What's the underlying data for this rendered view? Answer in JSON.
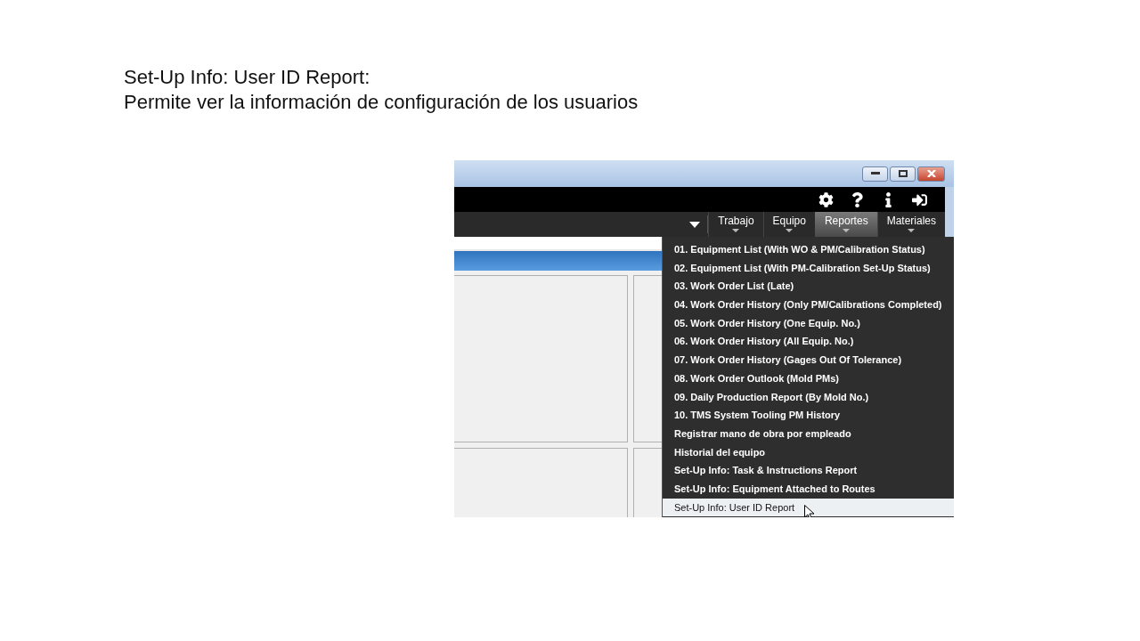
{
  "slide": {
    "heading": "Set-Up Info: User ID Report:",
    "subheading": "Permite ver la información de configuración de los usuarios"
  },
  "nav": {
    "tabs": [
      {
        "label": "Trabajo",
        "selected": false
      },
      {
        "label": "Equipo",
        "selected": false
      },
      {
        "label": "Reportes",
        "selected": true
      },
      {
        "label": "Materiales",
        "selected": false
      }
    ]
  },
  "menu": {
    "items": [
      {
        "label": "01. Equipment List (With WO & PM/Calibration Status)",
        "selected": false
      },
      {
        "label": "02. Equipment List (With PM-Calibration Set-Up Status)",
        "selected": false
      },
      {
        "label": "03. Work Order List (Late)",
        "selected": false
      },
      {
        "label": "04. Work Order History (Only PM/Calibrations Completed)",
        "selected": false
      },
      {
        "label": "05. Work Order History (One Equip. No.)",
        "selected": false
      },
      {
        "label": "06. Work Order History (All Equip. No.)",
        "selected": false
      },
      {
        "label": "07. Work Order History (Gages Out Of Tolerance)",
        "selected": false
      },
      {
        "label": "08. Work Order Outlook (Mold PMs)",
        "selected": false
      },
      {
        "label": "09. Daily Production Report (By Mold No.)",
        "selected": false
      },
      {
        "label": "10. TMS System Tooling PM History",
        "selected": false
      },
      {
        "label": "Registrar mano de obra por empleado",
        "selected": false
      },
      {
        "label": "Historial del equipo",
        "selected": false
      },
      {
        "label": "Set-Up Info: Task & Instructions Report",
        "selected": false
      },
      {
        "label": "Set-Up Info: Equipment Attached to Routes",
        "selected": false
      },
      {
        "label": "Set-Up Info: User ID Report",
        "selected": true
      }
    ]
  }
}
